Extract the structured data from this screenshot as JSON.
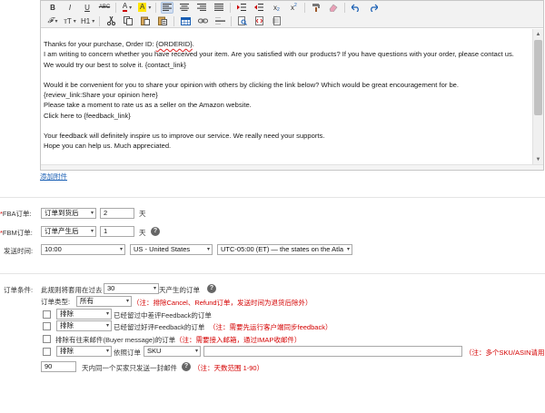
{
  "toolbar": {
    "row1": [
      "bold",
      "italic",
      "underline",
      "strikethrough",
      "font-color",
      "highlight-color",
      "align-left",
      "align-center",
      "align-right",
      "justify",
      "indent",
      "outdent",
      "subscript",
      "superscript",
      "format-painter",
      "clear-format",
      "undo",
      "redo"
    ],
    "bold": "B",
    "italic": "I",
    "underline": "U",
    "strike": "ABC",
    "font_color": "A",
    "highlight": "A",
    "subscript": "x",
    "superscript": "x",
    "font_family": "𝓕",
    "font_size": "тT",
    "heading": "H1"
  },
  "editor": {
    "line1_prefix": "Thanks for your purchase, Order ID: ",
    "line1_var": "{ORDERID}",
    "line1_suffix": ".",
    "line2": "I am writing to concern whether you have received your item. Are you satisfied with our products? If you have questions with your order, please contact us.",
    "line3": "We would try our best to solve it. {contact_link}",
    "line4": "Would it be convenient for you to share your opinion with others by clicking the link below? Which would be great encouragement for be.",
    "line5": "{review_link:Share your opinion here}",
    "line6": "Please take a moment to rate us as a seller on the Amazon website.",
    "line7": "Click here to {feedback_link}",
    "line8": "Your feedback will definitely inspire us to improve our service. We really need your supports.",
    "line9": "Hope you can help us. Much appreciated."
  },
  "add_attachment": "添加附件",
  "fba": {
    "label_star": "*",
    "label": "FBA订单:",
    "select": "订单到货后",
    "value": "2",
    "unit": "天"
  },
  "fbm": {
    "label_star": "*",
    "label": "FBM订单:",
    "select": "订单产生后",
    "value": "1",
    "unit": "天"
  },
  "send_time": {
    "label": "发送时间:",
    "time": "10:00",
    "country": "US - United States",
    "timezone": "UTC-05:00 (ET) — the states on the Atla"
  },
  "conditions": {
    "label": "订单条件:",
    "rule_prefix": "此规则将套用在过去",
    "days": "30",
    "rule_suffix": "天产生的订单",
    "type_label": "订单类型:",
    "type_value": "所有",
    "type_note": "（注：排除Cancel、Refund订单，发送时间为退货后除外）",
    "row1_select": "排除",
    "row1_text": "已经留过中差评Feedback的订单",
    "row2_select": "排除",
    "row2_text": "已经留过好评Feedback的订单",
    "row2_note": "（注：需要先运行客户端同步feedback）",
    "row3_text": "排除有往来邮件(Buyer message)的订单",
    "row3_note": "（注：需要接入邮箱，通过IMAP收邮件）",
    "row4_select": "排除",
    "row4_text": "依照订单",
    "row4_field": "SKU",
    "row4_note": "（注：多个SKU/ASIN请用,号",
    "limit_value": "90",
    "limit_text": "天内同一个买家只发送一封邮件",
    "limit_note": "（注：天数范围 1-90）"
  }
}
